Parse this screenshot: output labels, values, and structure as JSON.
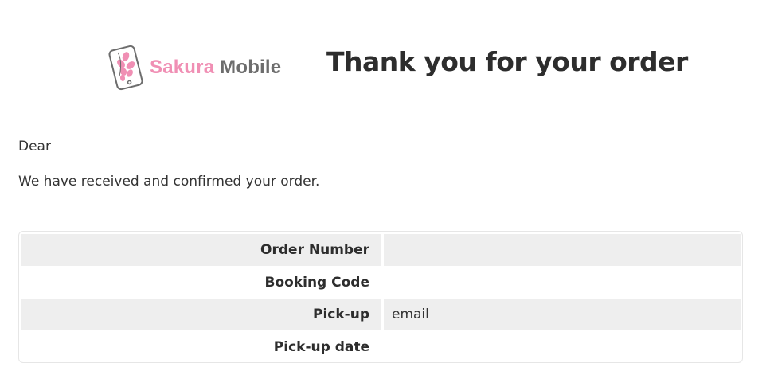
{
  "header": {
    "logo": {
      "name_part1": "Sakura",
      "name_part2": "Mobile",
      "brand_pink": "#f08fb4",
      "brand_gray": "#6d6d6d"
    },
    "title": "Thank you for your order"
  },
  "message": {
    "greeting": "Dear",
    "body": "We have received and confirmed your order."
  },
  "order_details": {
    "rows": [
      {
        "label": "Order Number",
        "value": ""
      },
      {
        "label": "Booking Code",
        "value": ""
      },
      {
        "label": "Pick-up",
        "value": "email"
      },
      {
        "label": "Pick-up date",
        "value": ""
      }
    ]
  }
}
